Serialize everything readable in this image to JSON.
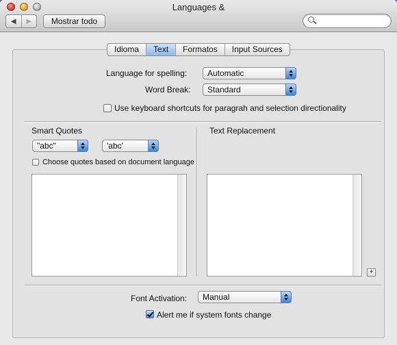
{
  "window": {
    "title": "Languages &"
  },
  "toolbar": {
    "back": "◀",
    "forward": "▶",
    "show_all": "Mostrar todo",
    "search_placeholder": ""
  },
  "tabs": [
    {
      "label": "Idioma",
      "active": false
    },
    {
      "label": "Text",
      "active": true
    },
    {
      "label": "Formatos",
      "active": false
    },
    {
      "label": "Input Sources",
      "active": false
    }
  ],
  "spelling": {
    "label": "Language for spelling:",
    "value": "Automatic"
  },
  "word_break": {
    "label": "Word Break:",
    "value": "Standard"
  },
  "keyboard_shortcuts": {
    "label": "Use keyboard shortcuts for paragrah and selection directionality",
    "checked": false
  },
  "smart_quotes": {
    "heading": "Smart Quotes",
    "double": "\"abc\"",
    "single": "'abc'",
    "doc_language": {
      "label": "Choose quotes based on document language",
      "checked": false
    }
  },
  "text_replacement": {
    "heading": "Text Replacement",
    "add": "+"
  },
  "font_activation": {
    "label": "Font Activation:",
    "value": "Manual"
  },
  "alert_fonts": {
    "label": "Alert me if system fonts change",
    "checked": true
  }
}
